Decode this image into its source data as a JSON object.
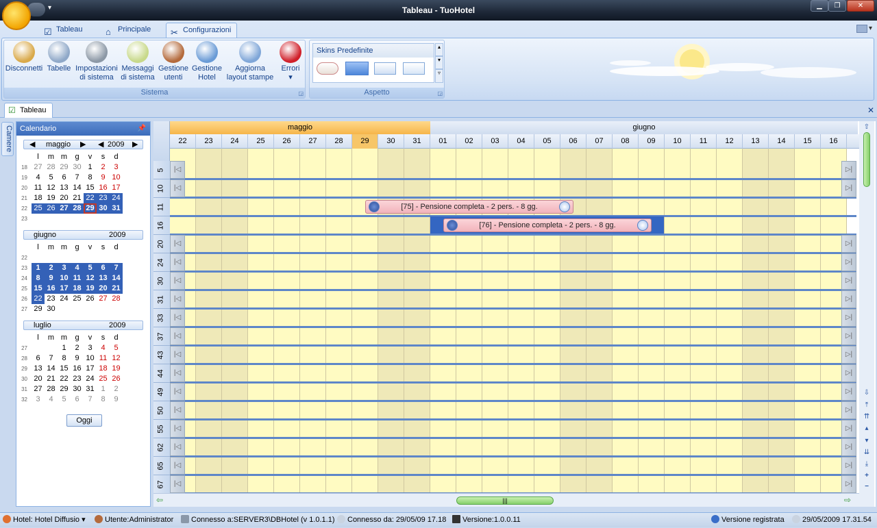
{
  "window": {
    "title": "Tableau - TuoHotel"
  },
  "ribbon": {
    "tabs": [
      {
        "label": "Tableau",
        "icon": "tableau-icon"
      },
      {
        "label": "Principale",
        "icon": "home-icon"
      },
      {
        "label": "Configurazioni",
        "icon": "tools-icon"
      }
    ],
    "active_tab": "Configurazioni",
    "sistema": {
      "label": "Sistema",
      "buttons": [
        {
          "l1": "Disconnetti",
          "l2": "",
          "icon": "disconnect-icon",
          "color": "#d9a94a"
        },
        {
          "l1": "Tabelle",
          "l2": "",
          "icon": "tables-icon",
          "color": "#8fa8c8"
        },
        {
          "l1": "Impostazioni",
          "l2": "di sistema",
          "icon": "gear-icon",
          "color": "#8c98a6"
        },
        {
          "l1": "Messaggi",
          "l2": "di sistema",
          "icon": "letter-a-icon",
          "color": "#c8d98a"
        },
        {
          "l1": "Gestione",
          "l2": "utenti",
          "icon": "user-icon",
          "color": "#b46a3c"
        },
        {
          "l1": "Gestione",
          "l2": "Hotel",
          "icon": "hotel-icon",
          "color": "#6a9bd6"
        },
        {
          "l1": "Aggiorna",
          "l2": "layout stampe",
          "icon": "print-layout-icon",
          "color": "#7fa6d8"
        },
        {
          "l1": "Errori",
          "l2": "▾",
          "icon": "error-icon",
          "color": "#d0202a"
        }
      ]
    },
    "aspetto": {
      "label": "Aspetto",
      "gallery_title": "Skins Predefinite"
    }
  },
  "document_tab": {
    "label": "Tableau"
  },
  "side_tab": {
    "label": "Camere"
  },
  "calendar": {
    "title": "Calendario",
    "weekdays": [
      "l",
      "m",
      "m",
      "g",
      "v",
      "s",
      "d"
    ],
    "months": [
      {
        "name": "maggio",
        "year": "2009",
        "weeks": [
          "18",
          "19",
          "20",
          "21",
          "22",
          "23"
        ],
        "rows": [
          [
            "27",
            "28",
            "29",
            "30",
            "1",
            "2",
            "3"
          ],
          [
            "4",
            "5",
            "6",
            "7",
            "8",
            "9",
            "10"
          ],
          [
            "11",
            "12",
            "13",
            "14",
            "15",
            "16",
            "17"
          ],
          [
            "18",
            "19",
            "20",
            "21",
            "22",
            "23",
            "24"
          ],
          [
            "25",
            "26",
            "27",
            "28",
            "29",
            "30",
            "31"
          ],
          [
            "",
            "",
            "",
            "",
            "",
            "",
            ""
          ]
        ]
      },
      {
        "name": "giugno",
        "year": "2009",
        "weeks": [
          "22",
          "23",
          "24",
          "25",
          "26",
          "27"
        ],
        "rows": [
          [
            "",
            "",
            "",
            "",
            "",
            "",
            ""
          ],
          [
            "1",
            "2",
            "3",
            "4",
            "5",
            "6",
            "7"
          ],
          [
            "8",
            "9",
            "10",
            "11",
            "12",
            "13",
            "14"
          ],
          [
            "15",
            "16",
            "17",
            "18",
            "19",
            "20",
            "21"
          ],
          [
            "22",
            "23",
            "24",
            "25",
            "26",
            "27",
            "28"
          ],
          [
            "29",
            "30",
            "",
            "",
            "",
            "",
            ""
          ]
        ]
      },
      {
        "name": "luglio",
        "year": "2009",
        "weeks": [
          "27",
          "28",
          "29",
          "30",
          "31",
          "32"
        ],
        "rows": [
          [
            "",
            "",
            "1",
            "2",
            "3",
            "4",
            "5"
          ],
          [
            "6",
            "7",
            "8",
            "9",
            "10",
            "11",
            "12"
          ],
          [
            "13",
            "14",
            "15",
            "16",
            "17",
            "18",
            "19"
          ],
          [
            "20",
            "21",
            "22",
            "23",
            "24",
            "25",
            "26"
          ],
          [
            "27",
            "28",
            "29",
            "30",
            "31",
            "1",
            "2"
          ],
          [
            "3",
            "4",
            "5",
            "6",
            "7",
            "8",
            "9"
          ]
        ]
      }
    ],
    "today_button": "Oggi"
  },
  "scheduler": {
    "months": [
      {
        "name": "maggio"
      },
      {
        "name": "giugno"
      }
    ],
    "days": [
      "22",
      "23",
      "24",
      "25",
      "26",
      "27",
      "28",
      "29",
      "30",
      "31",
      "01",
      "02",
      "03",
      "04",
      "05",
      "06",
      "07",
      "08",
      "09",
      "10",
      "11",
      "12",
      "13",
      "14",
      "15",
      "16"
    ],
    "rooms": [
      "5",
      "10",
      "11",
      "16",
      "20",
      "24",
      "30",
      "31",
      "33",
      "37",
      "43",
      "44",
      "49",
      "50",
      "55",
      "62",
      "65",
      "67"
    ],
    "bookings": [
      {
        "label": "[75] - Pensione completa  - 2 pers. - 8 gg.",
        "room": "11",
        "start": "29/05",
        "nights": 8
      },
      {
        "label": "[76] - Pensione completa  - 2 pers. - 8 gg.",
        "room": "16",
        "start": "01/06",
        "nights": 8
      }
    ]
  },
  "statusbar": {
    "hotel": "Hotel: Hotel Diffusio",
    "user": "Utente:Administrator",
    "connected": "Connesso a:SERVER3\\DBHotel (v 1.0.1.1)",
    "since": "Connesso da: 29/05/09 17.18",
    "version": "Versione:1.0.0.11",
    "registered": "Versione registrata",
    "datetime": "29/05/2009 17.31.54"
  }
}
